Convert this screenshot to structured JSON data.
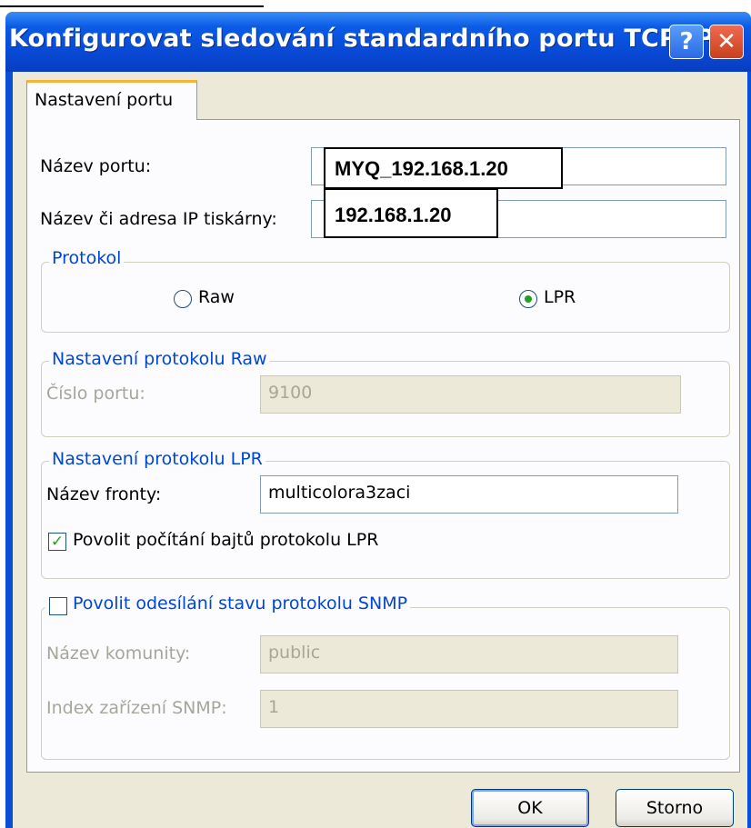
{
  "window": {
    "title": "Konfigurovat sledování standardního portu TCP/IP",
    "help_glyph": "?",
    "close_glyph": "✕"
  },
  "tab": {
    "label": "Nastavení portu"
  },
  "port": {
    "name_label": "Název portu:",
    "name_value": "MYQ_192.168.1.20",
    "printer_label": "Název či adresa IP tiskárny:",
    "printer_value": "192.168.1.20"
  },
  "protocol": {
    "legend": "Protokol",
    "raw_label": "Raw",
    "lpr_label": "LPR",
    "selected": "LPR"
  },
  "raw_settings": {
    "legend": "Nastavení protokolu Raw",
    "port_label": "Číslo portu:",
    "port_value": "9100"
  },
  "lpr_settings": {
    "legend": "Nastavení protokolu LPR",
    "queue_label": "Název fronty:",
    "queue_value": "multicolora3zaci",
    "byte_count_label": "Povolit počítání bajtů protokolu LPR",
    "byte_count_checked": true
  },
  "snmp": {
    "legend": "Povolit odesílání stavu protokolu SNMP",
    "enabled": false,
    "community_label": "Název komunity:",
    "community_value": "public",
    "device_index_label": "Index zařízení SNMP:",
    "device_index_value": "1"
  },
  "buttons": {
    "ok": "OK",
    "cancel": "Storno"
  },
  "colors": {
    "title_bar": "#0a4fd6",
    "group_legend": "#0046d5",
    "dialog_bg": "#ece9d8",
    "tab_accent": "#f4b43a"
  }
}
